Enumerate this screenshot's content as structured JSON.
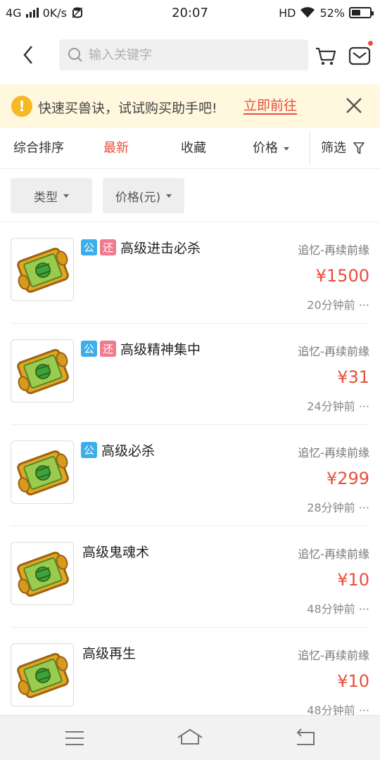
{
  "status_bar": {
    "network": "4G",
    "speed": "0K/s",
    "time": "20:07",
    "hd": "HD",
    "battery": "52%",
    "battery_level": 0.52
  },
  "header": {
    "back_icon": "chevron-left-icon",
    "search_placeholder": "输入关键字",
    "search_value": "",
    "cart_icon": "cart-icon",
    "mail_icon": "mail-icon",
    "has_notification": true
  },
  "banner": {
    "icon": "warning-icon",
    "message": "快速买兽诀，试试购买助手吧!",
    "link": "立即前往",
    "close_icon": "close-icon"
  },
  "sort_bar": {
    "items": [
      {
        "label": "综合排序",
        "active": false
      },
      {
        "label": "最新",
        "active": true
      },
      {
        "label": "收藏",
        "active": false
      },
      {
        "label": "价格",
        "active": false,
        "dropdown": true
      }
    ],
    "filter_label": "筛选",
    "filter_icon": "funnel-icon"
  },
  "filters": [
    {
      "label": "类型"
    },
    {
      "label": "价格(元)"
    }
  ],
  "items": [
    {
      "badges": [
        "公",
        "还"
      ],
      "title": "高级进击必杀",
      "server": "追忆-再续前缘",
      "price": "¥1500",
      "time": "20分钟前 ···"
    },
    {
      "badges": [
        "公",
        "还"
      ],
      "title": "高级精神集中",
      "server": "追忆-再续前缘",
      "price": "¥31",
      "time": "24分钟前 ···"
    },
    {
      "badges": [
        "公"
      ],
      "title": "高级必杀",
      "server": "追忆-再续前缘",
      "price": "¥299",
      "time": "28分钟前 ···"
    },
    {
      "badges": [],
      "title": "高级鬼魂术",
      "server": "追忆-再续前缘",
      "price": "¥10",
      "time": "48分钟前 ···"
    },
    {
      "badges": [],
      "title": "高级再生",
      "server": "追忆-再续前缘",
      "price": "¥10",
      "time": "48分钟前 ···"
    }
  ],
  "colors": {
    "accent": "#e94e3b",
    "badge_public": "#3daee9",
    "badge_return": "#f07a8f",
    "banner_bg": "#fff8df"
  }
}
